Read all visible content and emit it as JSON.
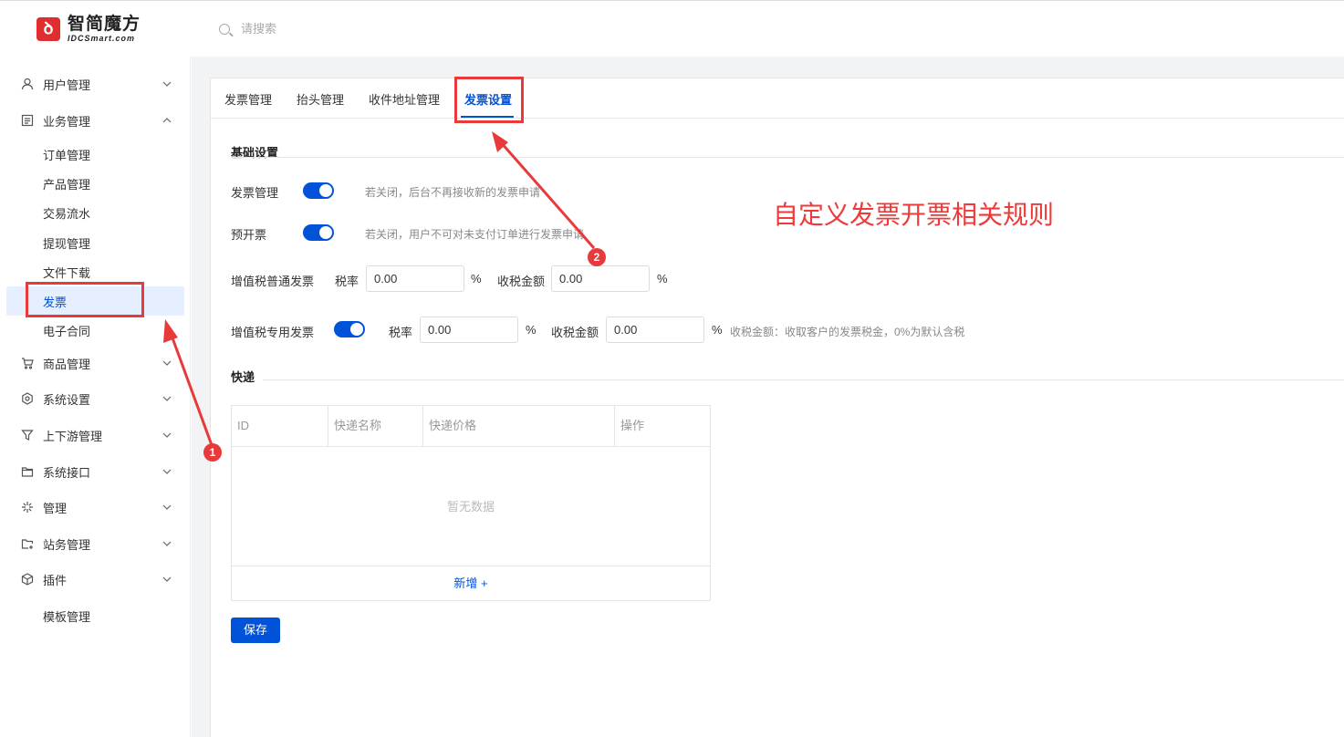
{
  "app": {
    "logo_name": "智简魔方",
    "logo_sub": "IDCSmart.com",
    "search_placeholder": "请搜索"
  },
  "sidebar": {
    "groups": [
      {
        "label": "用户管理",
        "icon": "user-icon"
      },
      {
        "label": "业务管理",
        "icon": "document-icon",
        "expanded": true
      },
      {
        "label": "商品管理",
        "icon": "cart-icon"
      },
      {
        "label": "系统设置",
        "icon": "settings-icon"
      },
      {
        "label": "上下游管理",
        "icon": "filter-icon"
      },
      {
        "label": "系统接口",
        "icon": "folder-icon"
      },
      {
        "label": "管理",
        "icon": "sparkle-icon"
      },
      {
        "label": "站务管理",
        "icon": "folder-add-icon"
      },
      {
        "label": "插件",
        "icon": "cube-icon"
      }
    ],
    "sub_items": [
      "订单管理",
      "产品管理",
      "交易流水",
      "提现管理",
      "文件下载",
      "发票",
      "电子合同"
    ],
    "active_sub": "发票",
    "extra_item": "模板管理"
  },
  "tabs": [
    "发票管理",
    "抬头管理",
    "收件地址管理",
    "发票设置"
  ],
  "active_tab": "发票设置",
  "basic": {
    "title": "基础设置",
    "invoice_mgmt_label": "发票管理",
    "invoice_mgmt_on": true,
    "invoice_mgmt_hint": "若关闭，后台不再接收新的发票申请",
    "pre_invoice_label": "预开票",
    "pre_invoice_on": true,
    "pre_invoice_hint": "若关闭，用户不可对未支付订单进行发票申请",
    "vat_normal_label": "增值税普通发票",
    "vat_special_label": "增值税专用发票",
    "vat_special_on": true,
    "tax_rate_label": "税率",
    "tax_amount_label": "收税金额",
    "percent": "%",
    "vat_normal_rate": "0.00",
    "vat_normal_amount": "0.00",
    "vat_special_rate": "0.00",
    "vat_special_amount": "0.00",
    "tax_amount_hint": "收税金额：收取客户的发票税金，0%为默认含税"
  },
  "express": {
    "title": "快递",
    "columns": [
      "ID",
      "快递名称",
      "快递价格",
      "操作"
    ],
    "empty_text": "暂无数据",
    "add_label": "新增 +"
  },
  "save_label": "保存",
  "annotation": {
    "callout": "自定义发票开票相关规则",
    "badge_1": "1",
    "badge_2": "2",
    "color": "#e83a3a"
  },
  "colors": {
    "primary": "#0052d9",
    "active_bg": "#e5efff"
  }
}
